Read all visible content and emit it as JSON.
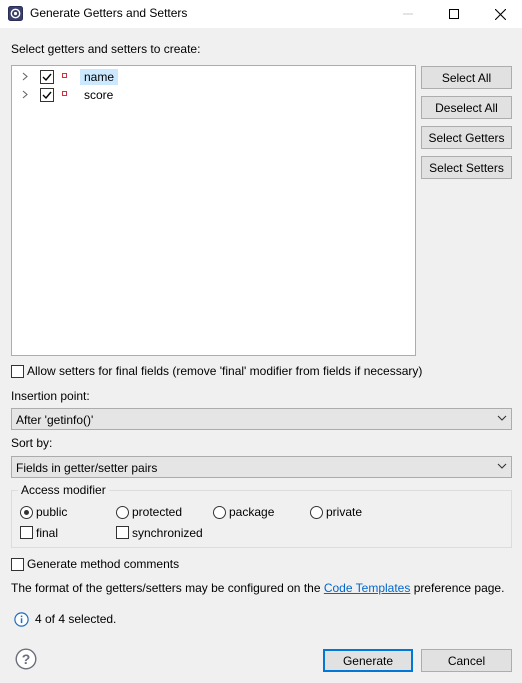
{
  "window": {
    "title": "Generate Getters and Setters",
    "controls": [
      "minimize",
      "maximize",
      "close"
    ]
  },
  "prompt": "Select getters and setters to create:",
  "tree": {
    "items": [
      {
        "label": "name",
        "checked": true,
        "icon": "field-icon",
        "selected": true
      },
      {
        "label": "score",
        "checked": true,
        "icon": "field-icon",
        "selected": false
      }
    ]
  },
  "side_buttons": {
    "select_all": "Select All",
    "deselect_all": "Deselect All",
    "select_getters": "Select Getters",
    "select_setters": "Select Setters"
  },
  "allow_final": {
    "label": "Allow setters for final fields (remove 'final' modifier from fields if necessary)",
    "checked": false
  },
  "insertion_point": {
    "label": "Insertion point:",
    "value": "After 'getinfo()'"
  },
  "sort_by": {
    "label": "Sort by:",
    "value": "Fields in getter/setter pairs"
  },
  "access_modifier": {
    "title": "Access modifier",
    "options": {
      "public": "public",
      "protected": "protected",
      "package": "package",
      "private": "private"
    },
    "selected": "public",
    "final_label": "final",
    "synchronized_label": "synchronized"
  },
  "generate_comments": {
    "label": "Generate method comments",
    "checked": false
  },
  "info": {
    "prefix": "The format of the getters/setters may be configured on the",
    "link": "Code Templates",
    "suffix": "preference page."
  },
  "status": "4 of 4 selected.",
  "footer": {
    "generate": "Generate",
    "cancel": "Cancel"
  }
}
